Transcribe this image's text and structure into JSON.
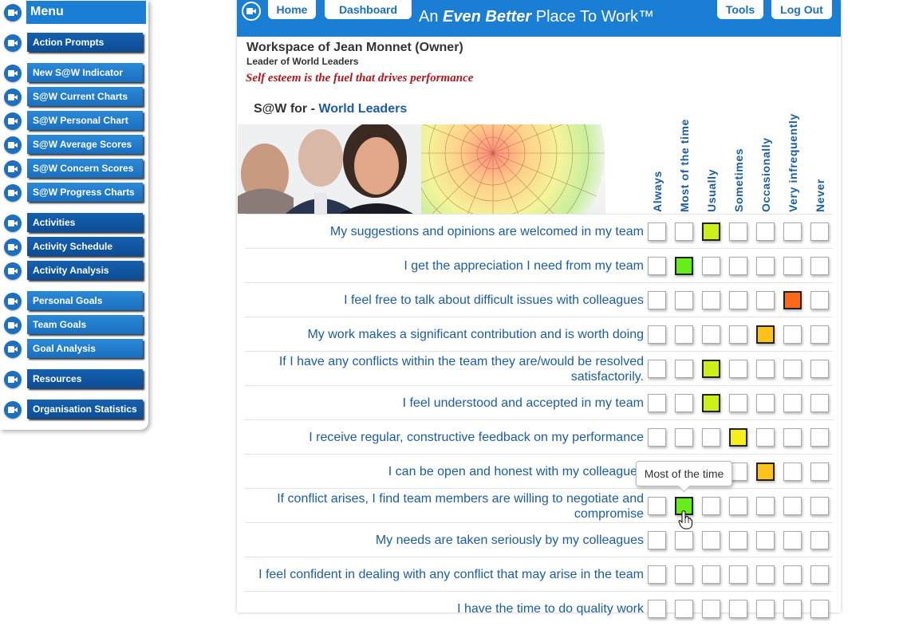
{
  "sidebar": {
    "title": "Menu",
    "items": [
      {
        "label": "Action Prompts",
        "dark": true
      },
      {
        "label": "New S@W Indicator",
        "dark": false
      },
      {
        "label": "S@W Current Charts",
        "dark": false
      },
      {
        "label": "S@W Personal Chart",
        "dark": false
      },
      {
        "label": "S@W Average Scores",
        "dark": false
      },
      {
        "label": "S@W Concern Scores",
        "dark": false
      },
      {
        "label": "S@W Progress Charts",
        "dark": false
      },
      {
        "label": "Activities",
        "dark": true
      },
      {
        "label": "Activity Schedule",
        "dark": true
      },
      {
        "label": "Activity Analysis",
        "dark": true
      },
      {
        "label": "Personal Goals",
        "dark": false
      },
      {
        "label": "Team Goals",
        "dark": false
      },
      {
        "label": "Goal Analysis",
        "dark": false
      },
      {
        "label": "Resources",
        "dark": true
      },
      {
        "label": "Organisation Statistics",
        "dark": true
      }
    ]
  },
  "header": {
    "home_label": "Home",
    "dashboard_label": "Dashboard",
    "title_pre": "An ",
    "title_em": "Even Better",
    "title_post": " Place To Work™",
    "tools_label": "Tools",
    "logout_label": "Log Out"
  },
  "workspace": {
    "title": "Workspace of Jean Monnet (Owner)",
    "subtitle": "Leader of World Leaders",
    "motto": "Self esteem is the fuel that drives performance",
    "saw_for_label": "S@W for - ",
    "group_name": "World Leaders"
  },
  "columns": [
    "Always",
    "Most of the time",
    "Usually",
    "Sometimes",
    "Occasionally",
    "Very infrequently",
    "Never"
  ],
  "column_colors": [
    "#5fd35f",
    "#66ee1a",
    "#ccf01a",
    "#f5f01a",
    "#ffc21a",
    "#ff6a1a",
    "#ee2222"
  ],
  "questions": [
    {
      "text": "My suggestions and opinions are welcomed in my team",
      "selected": 2
    },
    {
      "text": "I get the appreciation I need from my team",
      "selected": 1
    },
    {
      "text": "I feel free to talk about difficult issues with colleagues",
      "selected": 5
    },
    {
      "text": "My work makes a significant contribution and is worth doing",
      "selected": 4
    },
    {
      "text": "If I have any conflicts within the team they are/would be resolved satisfactorily.",
      "selected": 2
    },
    {
      "text": "I feel understood and accepted in my team",
      "selected": 2
    },
    {
      "text": "I receive regular, constructive feedback on my performance",
      "selected": 3
    },
    {
      "text": "I can be open and honest with my colleagues",
      "selected": 4
    },
    {
      "text": "If conflict arises, I find team members are willing to negotiate and compromise",
      "selected": 1
    },
    {
      "text": "My needs are taken seriously by my colleagues",
      "selected": -1
    },
    {
      "text": "I feel confident in dealing with any conflict that may arise in the team",
      "selected": -1
    },
    {
      "text": "I have the time to do quality work",
      "selected": -1
    }
  ],
  "tooltip": "Most of the time"
}
